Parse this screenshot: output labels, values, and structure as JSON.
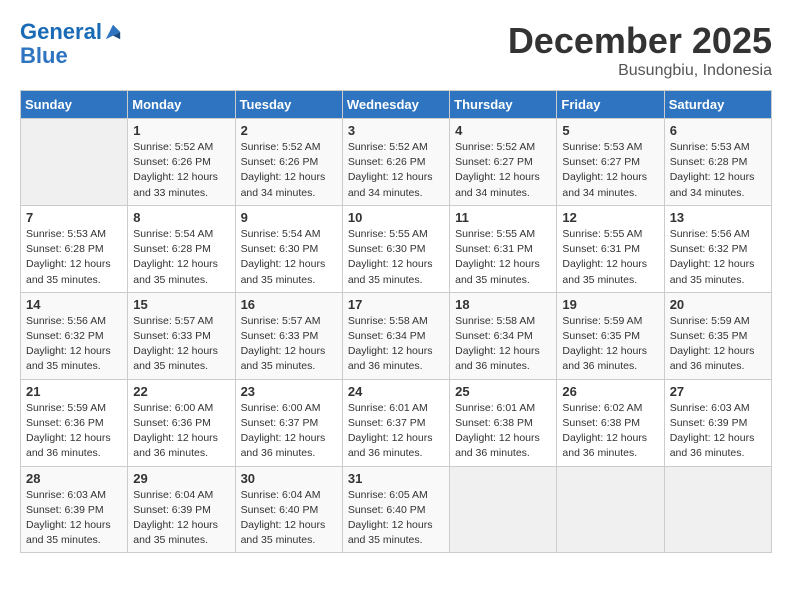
{
  "header": {
    "logo_line1": "General",
    "logo_line2": "Blue",
    "month": "December 2025",
    "location": "Busungbiu, Indonesia"
  },
  "days_of_week": [
    "Sunday",
    "Monday",
    "Tuesday",
    "Wednesday",
    "Thursday",
    "Friday",
    "Saturday"
  ],
  "weeks": [
    [
      {
        "day": "",
        "info": ""
      },
      {
        "day": "1",
        "info": "Sunrise: 5:52 AM\nSunset: 6:26 PM\nDaylight: 12 hours\nand 33 minutes."
      },
      {
        "day": "2",
        "info": "Sunrise: 5:52 AM\nSunset: 6:26 PM\nDaylight: 12 hours\nand 34 minutes."
      },
      {
        "day": "3",
        "info": "Sunrise: 5:52 AM\nSunset: 6:26 PM\nDaylight: 12 hours\nand 34 minutes."
      },
      {
        "day": "4",
        "info": "Sunrise: 5:52 AM\nSunset: 6:27 PM\nDaylight: 12 hours\nand 34 minutes."
      },
      {
        "day": "5",
        "info": "Sunrise: 5:53 AM\nSunset: 6:27 PM\nDaylight: 12 hours\nand 34 minutes."
      },
      {
        "day": "6",
        "info": "Sunrise: 5:53 AM\nSunset: 6:28 PM\nDaylight: 12 hours\nand 34 minutes."
      }
    ],
    [
      {
        "day": "7",
        "info": "Sunrise: 5:53 AM\nSunset: 6:28 PM\nDaylight: 12 hours\nand 35 minutes."
      },
      {
        "day": "8",
        "info": "Sunrise: 5:54 AM\nSunset: 6:28 PM\nDaylight: 12 hours\nand 35 minutes."
      },
      {
        "day": "9",
        "info": "Sunrise: 5:54 AM\nSunset: 6:30 PM\nDaylight: 12 hours\nand 35 minutes."
      },
      {
        "day": "10",
        "info": "Sunrise: 5:55 AM\nSunset: 6:30 PM\nDaylight: 12 hours\nand 35 minutes."
      },
      {
        "day": "11",
        "info": "Sunrise: 5:55 AM\nSunset: 6:31 PM\nDaylight: 12 hours\nand 35 minutes."
      },
      {
        "day": "12",
        "info": "Sunrise: 5:55 AM\nSunset: 6:31 PM\nDaylight: 12 hours\nand 35 minutes."
      },
      {
        "day": "13",
        "info": "Sunrise: 5:56 AM\nSunset: 6:32 PM\nDaylight: 12 hours\nand 35 minutes."
      }
    ],
    [
      {
        "day": "14",
        "info": "Sunrise: 5:56 AM\nSunset: 6:32 PM\nDaylight: 12 hours\nand 35 minutes."
      },
      {
        "day": "15",
        "info": "Sunrise: 5:57 AM\nSunset: 6:33 PM\nDaylight: 12 hours\nand 35 minutes."
      },
      {
        "day": "16",
        "info": "Sunrise: 5:57 AM\nSunset: 6:33 PM\nDaylight: 12 hours\nand 35 minutes."
      },
      {
        "day": "17",
        "info": "Sunrise: 5:58 AM\nSunset: 6:34 PM\nDaylight: 12 hours\nand 36 minutes."
      },
      {
        "day": "18",
        "info": "Sunrise: 5:58 AM\nSunset: 6:34 PM\nDaylight: 12 hours\nand 36 minutes."
      },
      {
        "day": "19",
        "info": "Sunrise: 5:59 AM\nSunset: 6:35 PM\nDaylight: 12 hours\nand 36 minutes."
      },
      {
        "day": "20",
        "info": "Sunrise: 5:59 AM\nSunset: 6:35 PM\nDaylight: 12 hours\nand 36 minutes."
      }
    ],
    [
      {
        "day": "21",
        "info": "Sunrise: 5:59 AM\nSunset: 6:36 PM\nDaylight: 12 hours\nand 36 minutes."
      },
      {
        "day": "22",
        "info": "Sunrise: 6:00 AM\nSunset: 6:36 PM\nDaylight: 12 hours\nand 36 minutes."
      },
      {
        "day": "23",
        "info": "Sunrise: 6:00 AM\nSunset: 6:37 PM\nDaylight: 12 hours\nand 36 minutes."
      },
      {
        "day": "24",
        "info": "Sunrise: 6:01 AM\nSunset: 6:37 PM\nDaylight: 12 hours\nand 36 minutes."
      },
      {
        "day": "25",
        "info": "Sunrise: 6:01 AM\nSunset: 6:38 PM\nDaylight: 12 hours\nand 36 minutes."
      },
      {
        "day": "26",
        "info": "Sunrise: 6:02 AM\nSunset: 6:38 PM\nDaylight: 12 hours\nand 36 minutes."
      },
      {
        "day": "27",
        "info": "Sunrise: 6:03 AM\nSunset: 6:39 PM\nDaylight: 12 hours\nand 36 minutes."
      }
    ],
    [
      {
        "day": "28",
        "info": "Sunrise: 6:03 AM\nSunset: 6:39 PM\nDaylight: 12 hours\nand 35 minutes."
      },
      {
        "day": "29",
        "info": "Sunrise: 6:04 AM\nSunset: 6:39 PM\nDaylight: 12 hours\nand 35 minutes."
      },
      {
        "day": "30",
        "info": "Sunrise: 6:04 AM\nSunset: 6:40 PM\nDaylight: 12 hours\nand 35 minutes."
      },
      {
        "day": "31",
        "info": "Sunrise: 6:05 AM\nSunset: 6:40 PM\nDaylight: 12 hours\nand 35 minutes."
      },
      {
        "day": "",
        "info": ""
      },
      {
        "day": "",
        "info": ""
      },
      {
        "day": "",
        "info": ""
      }
    ]
  ]
}
